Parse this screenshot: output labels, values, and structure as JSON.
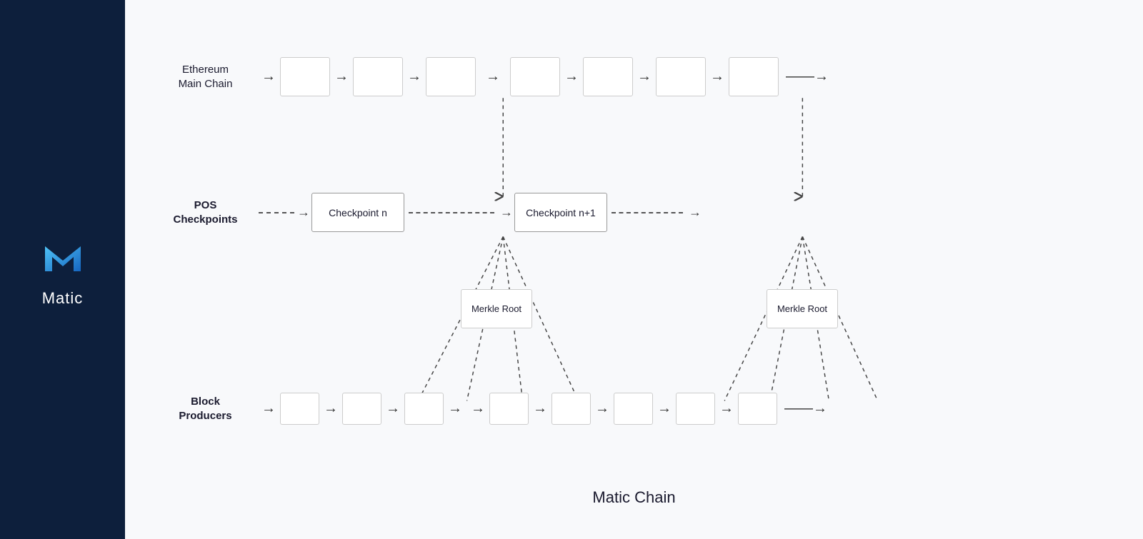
{
  "sidebar": {
    "logo_text": "Matic",
    "background_color": "#0d1f3c"
  },
  "diagram": {
    "ethereum_row_label": "Ethereum\nMain Chain",
    "pos_row_label": "POS\nCheckpoints",
    "block_producers_label": "Block\nProducers",
    "checkpoint_n_label": "Checkpoint n",
    "checkpoint_n1_label": "Checkpoint n+1",
    "merkle_root_label": "Merkle\nRoot",
    "matic_chain_label": "Matic Chain",
    "arrow_right": "→",
    "dashed_arrow_right": "- - →"
  }
}
